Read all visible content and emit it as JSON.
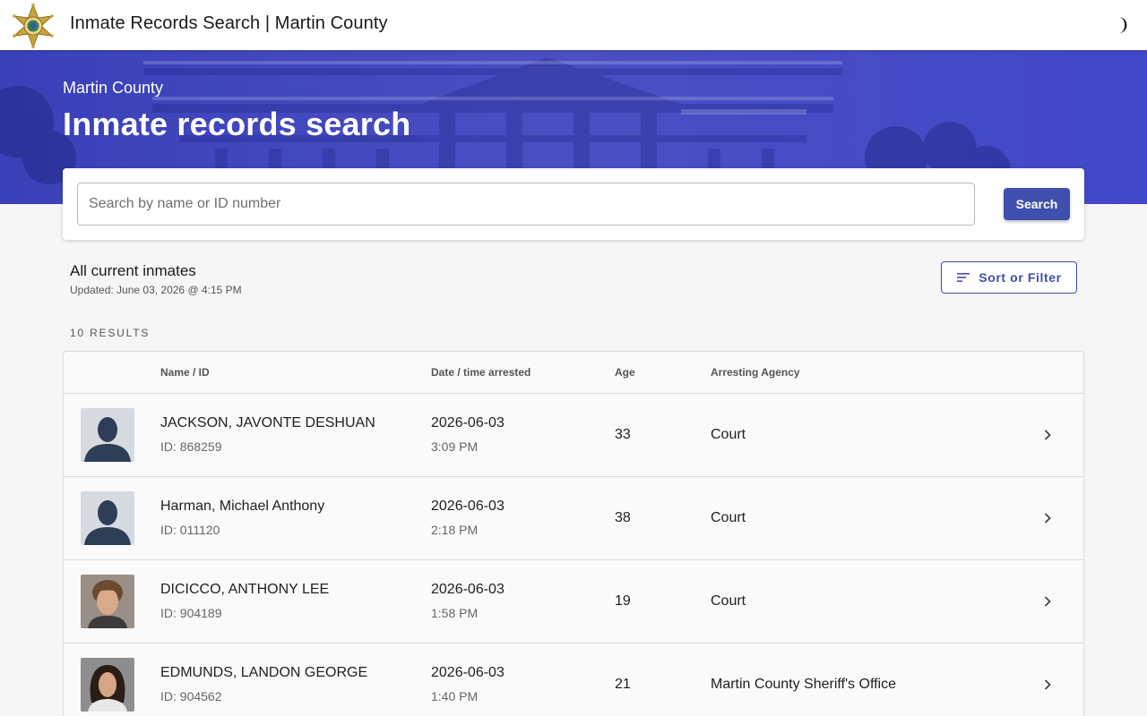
{
  "appbar": {
    "title": "Inmate Records Search | Martin County",
    "logo": "sheriff-star-badge",
    "theme_toggle_icon": "moon-icon"
  },
  "hero": {
    "subtitle": "Martin County",
    "title": "Inmate records search",
    "color": "#3f45c8"
  },
  "search": {
    "placeholder": "Search by name or ID number",
    "value": "",
    "button_label": "Search"
  },
  "list": {
    "title": "All current inmates",
    "updated": "Updated: June 03, 2026 @ 4:15 PM",
    "sort_label": "Sort or Filter",
    "results_count": "10 RESULTS"
  },
  "table": {
    "columns": [
      "Name / ID",
      "Date / time arrested",
      "Age",
      "Arresting Agency"
    ],
    "rows": [
      {
        "name": "JACKSON, JAVONTE DESHUAN",
        "id": "ID: 868259",
        "date": "2026-06-03",
        "time": "3:09 PM",
        "age": "33",
        "agency": "Court",
        "photo": "silhouette"
      },
      {
        "name": "Harman, Michael Anthony",
        "id": "ID: 011120",
        "date": "2026-06-03",
        "time": "2:18 PM",
        "age": "38",
        "agency": "Court",
        "photo": "silhouette"
      },
      {
        "name": "DICICCO, ANTHONY LEE",
        "id": "ID: 904189",
        "date": "2026-06-03",
        "time": "1:58 PM",
        "age": "19",
        "agency": "Court",
        "photo": "mugshot"
      },
      {
        "name": "EDMUNDS, LANDON GEORGE",
        "id": "ID: 904562",
        "date": "2026-06-03",
        "time": "1:40 PM",
        "age": "21",
        "agency": "Martin County Sheriff's Office",
        "photo": "mugshot"
      }
    ]
  },
  "colors": {
    "primary": "#3f4fae",
    "background": "#f6f6f7"
  }
}
